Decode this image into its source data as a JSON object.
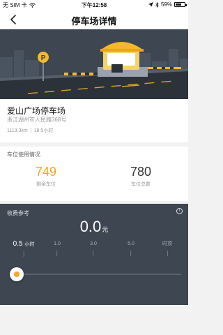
{
  "status_bar": {
    "carrier": "无 SIM 卡",
    "time": "下午12:58",
    "battery": "59%",
    "battery_level": 0.59
  },
  "nav": {
    "title": "停车场详情"
  },
  "banner": {
    "parking_sign": "P"
  },
  "lot": {
    "name": "爱山广场停车场",
    "address": "浙江湖州市人民路368号",
    "distance": "1113.3km",
    "duration": "18.5小时"
  },
  "usage": {
    "title": "车位使用情况",
    "remaining_value": "749",
    "remaining_label": "剩余车位",
    "total_value": "780",
    "total_label": "车位总数"
  },
  "fee": {
    "title": "收费参考",
    "info_icon": "i",
    "amount": "0.0",
    "unit": "元",
    "ticks": [
      {
        "value": "0.5",
        "unit": "小时",
        "selected": true
      },
      {
        "value": "1.0",
        "unit": "",
        "selected": false
      },
      {
        "value": "3.0",
        "unit": "",
        "selected": false
      },
      {
        "value": "5.0",
        "unit": "",
        "selected": false
      },
      {
        "value": "时顶",
        "unit": "",
        "selected": false
      }
    ],
    "slider_value": 0.5
  },
  "colors": {
    "accent": "#f5a623",
    "dark_panel": "#3d4651",
    "background": "#f2f2f2"
  }
}
